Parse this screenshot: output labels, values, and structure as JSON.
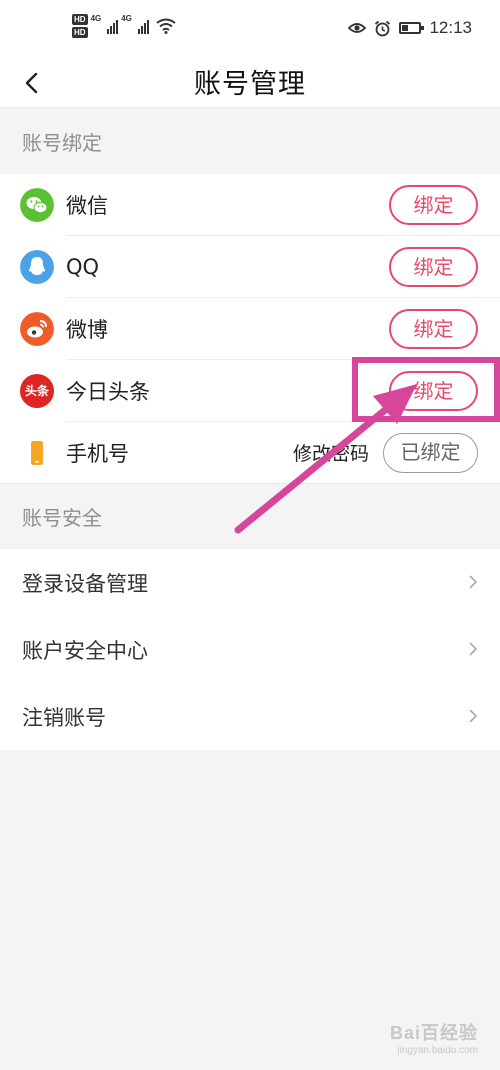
{
  "status_bar": {
    "network_1": "4G",
    "network_2": "4G",
    "hd_1": "HD",
    "hd_2": "HD",
    "time": "12:13",
    "battery_level": 0.4,
    "icons": [
      "eye-comfort-icon",
      "alarm-icon",
      "battery-icon",
      "wifi-icon",
      "signal-icon"
    ]
  },
  "header": {
    "title": "账号管理",
    "back_icon": "chevron-left-icon"
  },
  "binding_section": {
    "title": "账号绑定",
    "accounts": [
      {
        "name": "微信",
        "button": "绑定",
        "icon": "wechat-icon",
        "color": "#5ac134"
      },
      {
        "name": "QQ",
        "button": "绑定",
        "icon": "qq-icon",
        "color": "#4aa3e8"
      },
      {
        "name": "微博",
        "button": "绑定",
        "icon": "weibo-icon",
        "color": "#ef5b2b"
      },
      {
        "name": "今日头条",
        "button": "绑定",
        "icon": "toutiao-icon",
        "color": "#e02525",
        "logo_text": "头条"
      }
    ],
    "phone": {
      "name": "手机号",
      "change_password": "修改密码",
      "status": "已绑定",
      "icon": "phone-icon",
      "color": "#f5a623"
    }
  },
  "security_section": {
    "title": "账号安全",
    "items": [
      {
        "label": "登录设备管理"
      },
      {
        "label": "账户安全中心"
      },
      {
        "label": "注销账号"
      }
    ]
  },
  "colors": {
    "accent": "#e8496a",
    "annotation": "#d6469a"
  },
  "watermark": {
    "line1": "Bai百经验",
    "line2": "jingyan.baidu.com"
  }
}
